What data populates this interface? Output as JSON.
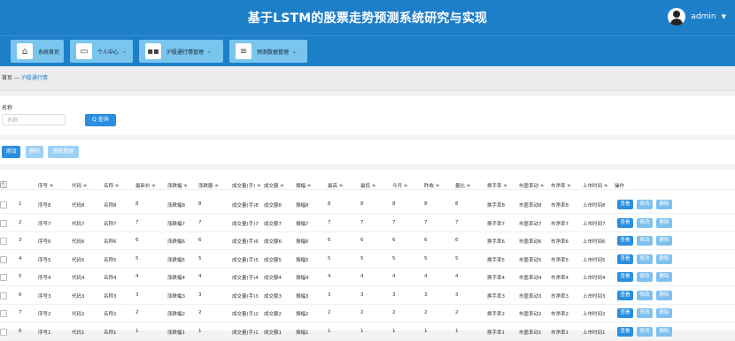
{
  "header": {
    "title": "基于LSTM的股票走势预测系统研究与实现",
    "user": "admin"
  },
  "nav": [
    {
      "label": "系统首页",
      "icon": "home-icon",
      "dropdown": false
    },
    {
      "label": "个人中心",
      "icon": "window-icon",
      "dropdown": true
    },
    {
      "label": "沪股通行情管理",
      "icon": "grid-icon",
      "dropdown": true
    },
    {
      "label": "预测数据管理",
      "icon": "menu-icon",
      "dropdown": true
    }
  ],
  "breadcrumb": {
    "home": "首页",
    "sep": "—",
    "current": "沪股通行情"
  },
  "search": {
    "label": "名称",
    "placeholder": "名称",
    "button": "Q 查询"
  },
  "actions": {
    "add": "添加",
    "delete": "删除",
    "fetch": "爬取数据"
  },
  "table": {
    "headers": [
      "序号 ≑",
      "代码 ≑",
      "名称 ≑",
      "最新价 ≑",
      "涨跌幅 ≑",
      "涨跌额 ≑",
      "成交量(手) ≑",
      "成交额 ≑",
      "振幅 ≑",
      "最高 ≑",
      "最低 ≑",
      "今开 ≑",
      "昨收 ≑",
      "量比 ≑",
      "换手率 ≑",
      "市盈率动 ≑",
      "市净率 ≑",
      "上市时间 ≑",
      "操作"
    ],
    "index_header": "",
    "row_buttons": {
      "view": "查看",
      "edit": "修改",
      "delete": "删除"
    },
    "rows": [
      {
        "idx": "1",
        "cells": [
          "序号8",
          "代码8",
          "名称8",
          "8",
          "涨跌幅8",
          "8",
          "成交量(手)8",
          "成交额8",
          "振幅8",
          "8",
          "8",
          "8",
          "8",
          "8",
          "换手率8",
          "市盈率动8",
          "市净率8",
          "上市时间8"
        ]
      },
      {
        "idx": "2",
        "cells": [
          "序号7",
          "代码7",
          "名称7",
          "7",
          "涨跌幅7",
          "7",
          "成交量(手)7",
          "成交额7",
          "振幅7",
          "7",
          "7",
          "7",
          "7",
          "7",
          "换手率7",
          "市盈率动7",
          "市净率7",
          "上市时间7"
        ]
      },
      {
        "idx": "3",
        "cells": [
          "序号6",
          "代码6",
          "名称6",
          "6",
          "涨跌幅6",
          "6",
          "成交量(手)6",
          "成交额6",
          "振幅6",
          "6",
          "6",
          "6",
          "6",
          "6",
          "换手率6",
          "市盈率动6",
          "市净率6",
          "上市时间6"
        ]
      },
      {
        "idx": "4",
        "cells": [
          "序号5",
          "代码5",
          "名称5",
          "5",
          "涨跌幅5",
          "5",
          "成交量(手)5",
          "成交额5",
          "振幅5",
          "5",
          "5",
          "5",
          "5",
          "5",
          "换手率5",
          "市盈率动5",
          "市净率5",
          "上市时间5"
        ]
      },
      {
        "idx": "5",
        "cells": [
          "序号4",
          "代码4",
          "名称4",
          "4",
          "涨跌幅4",
          "4",
          "成交量(手)4",
          "成交额4",
          "振幅4",
          "4",
          "4",
          "4",
          "4",
          "4",
          "换手率4",
          "市盈率动4",
          "市净率4",
          "上市时间4"
        ]
      },
      {
        "idx": "6",
        "cells": [
          "序号3",
          "代码3",
          "名称3",
          "3",
          "涨跌幅3",
          "3",
          "成交量(手)3",
          "成交额3",
          "振幅3",
          "3",
          "3",
          "3",
          "3",
          "3",
          "换手率3",
          "市盈率动3",
          "市净率3",
          "上市时间3"
        ]
      },
      {
        "idx": "7",
        "cells": [
          "序号2",
          "代码2",
          "名称2",
          "2",
          "涨跌幅2",
          "2",
          "成交量(手)2",
          "成交额2",
          "振幅2",
          "2",
          "2",
          "2",
          "2",
          "2",
          "换手率2",
          "市盈率动2",
          "市净率2",
          "上市时间2"
        ]
      },
      {
        "idx": "8",
        "cells": [
          "序号1",
          "代码1",
          "名称1",
          "1",
          "涨跌幅1",
          "1",
          "成交量(手)1",
          "成交额1",
          "振幅1",
          "1",
          "1",
          "1",
          "1",
          "1",
          "换手率1",
          "市盈率动1",
          "市净率1",
          "上市时间1"
        ]
      }
    ]
  },
  "colors": {
    "header": "#1e7fc9",
    "nav_item": "#79c5ee",
    "primary": "#2b8fe0",
    "light": "#7fc0ef",
    "lighter": "#9ed0f5"
  }
}
